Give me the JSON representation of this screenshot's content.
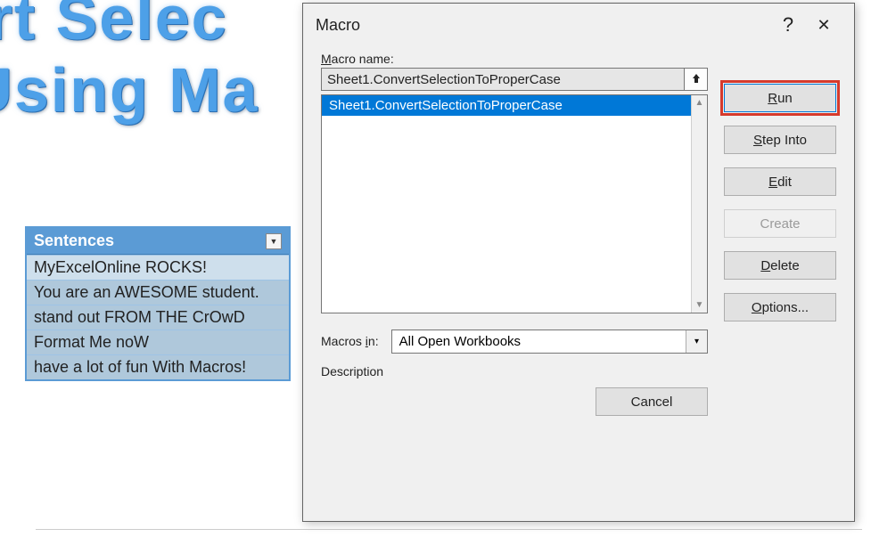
{
  "background_title": {
    "line1": "nvert Selec",
    "line2": "se Using Ma"
  },
  "table": {
    "header": "Sentences",
    "rows": [
      "MyExcelOnline ROCKS!",
      "You are an AWESOME student.",
      "stand out FROM THE CrOwD",
      "Format Me noW",
      "have a lot of fun With Macros!"
    ]
  },
  "dialog": {
    "title": "Macro",
    "labels": {
      "macro_name": "Macro name:",
      "macros_in": "Macros in:",
      "description": "Description"
    },
    "macro_name_value": "Sheet1.ConvertSelectionToProperCase",
    "list_items": [
      "Sheet1.ConvertSelectionToProperCase"
    ],
    "macros_in_value": "All Open Workbooks",
    "buttons": {
      "run": "Run",
      "step_into": "Step Into",
      "edit": "Edit",
      "create": "Create",
      "delete": "Delete",
      "options": "Options...",
      "cancel": "Cancel"
    }
  }
}
